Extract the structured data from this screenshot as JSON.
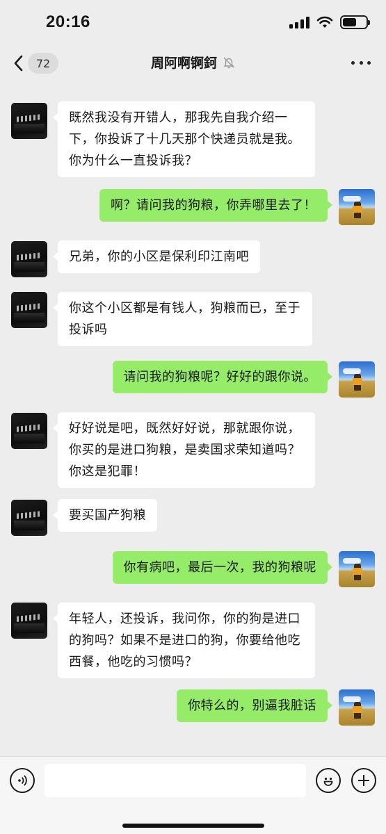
{
  "status_bar": {
    "time": "20:16",
    "battery_level": 0.6
  },
  "nav": {
    "unread_count": "72",
    "title": "周阿啊锕鈳",
    "muted": true
  },
  "messages": [
    {
      "side": "left",
      "text": "既然我没有开错人，那我先自我介绍一下，你投诉了十几天那个快递员就是我。你为什么一直投诉我？"
    },
    {
      "side": "right",
      "text": "啊？请问我的狗粮，你弄哪里去了！"
    },
    {
      "side": "left",
      "text": "兄弟，你的小区是保利印江南吧"
    },
    {
      "side": "left",
      "text": "你这个小区都是有钱人，狗粮而已，至于投诉吗"
    },
    {
      "side": "right",
      "text": "请问我的狗粮呢？好好的跟你说。"
    },
    {
      "side": "left",
      "text": "好好说是吧，既然好好说，那就跟你说，你买的是进口狗粮，是卖国求荣知道吗？你这是犯罪！"
    },
    {
      "side": "left",
      "text": "要买国产狗粮"
    },
    {
      "side": "right",
      "text": "你有病吧，最后一次，我的狗粮呢"
    },
    {
      "side": "left",
      "text": "年轻人，还投诉，我问你，你的狗是进口的狗吗？如果不是进口的狗，你要给他吃西餐，他吃的习惯吗？"
    },
    {
      "side": "right",
      "text": "你特么的，别逼我脏话"
    }
  ],
  "icons": {
    "back": "chevron-left-icon",
    "mute": "bell-off-icon",
    "more": "ellipsis-icon",
    "voice": "voice-icon",
    "emoji": "emoji-icon",
    "plus": "plus-icon"
  },
  "colors": {
    "background": "#ededed",
    "bubble_left": "#ffffff",
    "bubble_right": "#95ec69"
  }
}
